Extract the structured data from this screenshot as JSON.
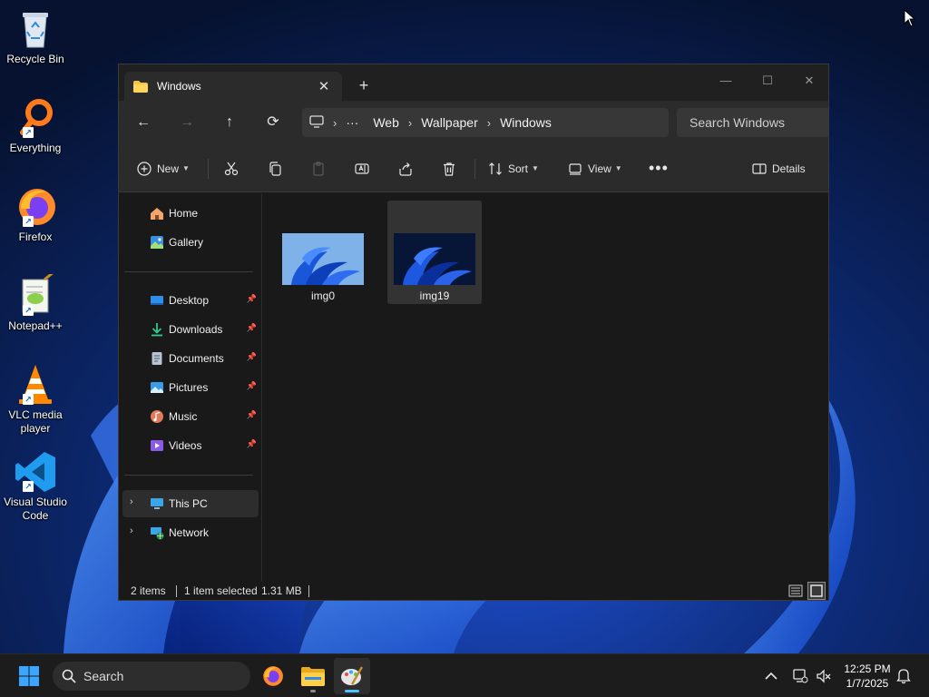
{
  "desktop": {
    "icons": [
      {
        "label": "Recycle Bin"
      },
      {
        "label": "Everything"
      },
      {
        "label": "Firefox"
      },
      {
        "label": "Notepad++"
      },
      {
        "label": "VLC media player"
      },
      {
        "label": "Visual Studio Code"
      }
    ]
  },
  "explorer": {
    "tab_title": "Windows",
    "breadcrumb": [
      "Web",
      "Wallpaper",
      "Windows"
    ],
    "search_placeholder": "Search Windows",
    "toolbar": {
      "new_label": "New",
      "sort_label": "Sort",
      "view_label": "View",
      "details_label": "Details"
    },
    "nav": {
      "quick": [
        "Home",
        "Gallery"
      ],
      "pinned": [
        "Desktop",
        "Downloads",
        "Documents",
        "Pictures",
        "Music",
        "Videos"
      ],
      "locations": [
        "This PC",
        "Network"
      ]
    },
    "files": [
      {
        "name": "img0",
        "selected": false
      },
      {
        "name": "img19",
        "selected": true
      }
    ],
    "status": {
      "count": "2 items",
      "selection": "1 item selected",
      "size": "1.31 MB"
    }
  },
  "taskbar": {
    "search_placeholder": "Search",
    "time": "12:25 PM",
    "date": "1/7/2025"
  },
  "colors": {
    "accent": "#4cc2ff",
    "window_bg": "#191919",
    "toolbar_bg": "#2b2b2b",
    "taskbar_bg": "#1c1c1c"
  }
}
